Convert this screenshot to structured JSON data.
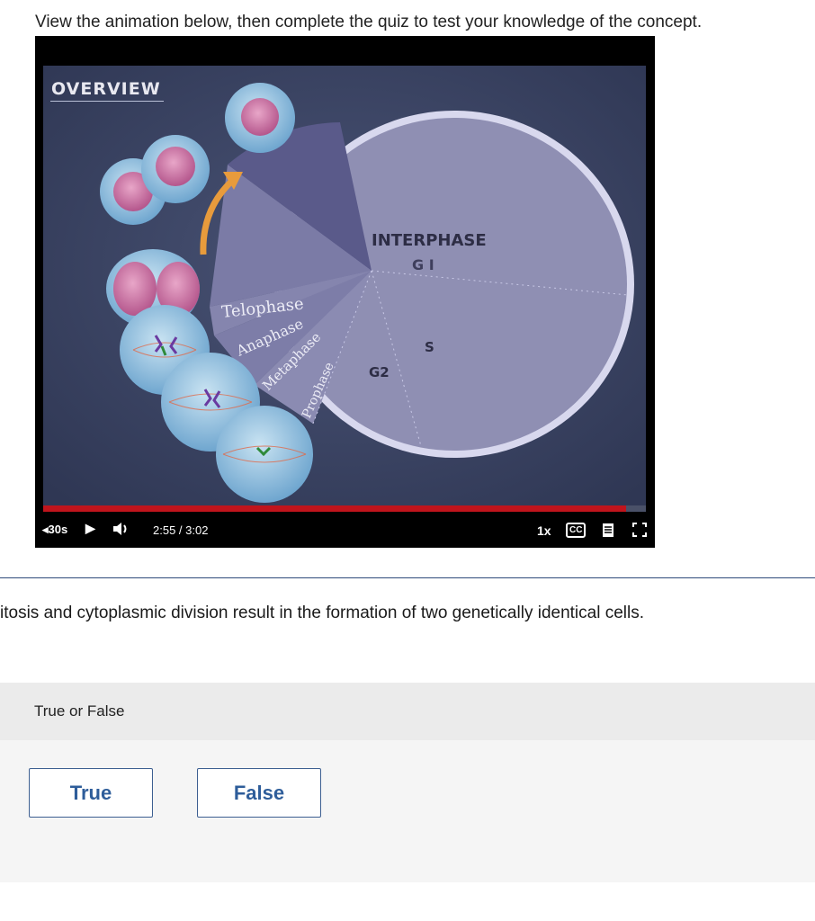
{
  "instructions": "View the animation below, then complete the quiz to test your knowledge of the concept.",
  "video": {
    "overview": "OVERVIEW",
    "labels": {
      "interphase": "INTERPHASE",
      "g1": "G I",
      "s": "S",
      "g2": "G2",
      "telophase": "Telophase",
      "anaphase": "Anaphase",
      "metaphase": "Metaphase",
      "prophase": "Prophase"
    },
    "progress": 0.967,
    "colors": {
      "progress": "#c0141c",
      "background": "#3b4563",
      "pie": "#8f8fb3",
      "ring": "#d8d8ee",
      "arrow": "#e89b3c"
    }
  },
  "controls": {
    "rewind": "◂30s",
    "play_icon": "play-icon",
    "time": "2:55 / 3:02",
    "speed": "1x",
    "cc": "CC"
  },
  "question": {
    "text": "itosis and cytoplasmic division result in the formation of two genetically identical cells.",
    "type_label": "True or False",
    "options": [
      "True",
      "False"
    ]
  }
}
